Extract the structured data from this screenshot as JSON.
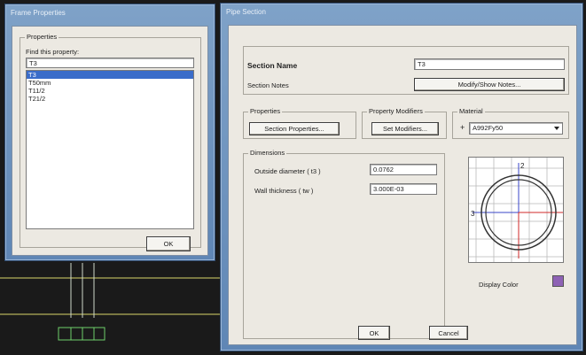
{
  "frame_dialog": {
    "title": "Frame Properties",
    "group_label": "Properties",
    "find_label": "Find this property:",
    "find_value": "T3",
    "items": [
      {
        "label": "T3",
        "selected": true
      },
      {
        "label": "T50mm",
        "selected": false
      },
      {
        "label": "T11/2",
        "selected": false
      },
      {
        "label": "T21/2",
        "selected": false
      }
    ],
    "ok_label": "OK"
  },
  "pipe_dialog": {
    "title": "Pipe Section",
    "section_name_label": "Section Name",
    "section_name_value": "T3",
    "section_notes_label": "Section Notes",
    "modify_notes_label": "Modify/Show Notes...",
    "properties_group": "Properties",
    "section_properties_label": "Section Properties...",
    "modifiers_group": "Property Modifiers",
    "set_modifiers_label": "Set Modifiers...",
    "material_group": "Material",
    "material_plus": "+",
    "material_value": "A992Fy50",
    "dimensions_group": "Dimensions",
    "outside_diameter_label": "Outside diameter  ( t3 )",
    "outside_diameter_value": "0.0762",
    "wall_thickness_label": "Wall thickness  ( tw )",
    "wall_thickness_value": "3.000E-03",
    "preview_axis_2": "2",
    "preview_axis_3": "3",
    "display_color_label": "Display Color",
    "display_color": "#8e62b5",
    "ok_label": "OK",
    "cancel_label": "Cancel"
  }
}
